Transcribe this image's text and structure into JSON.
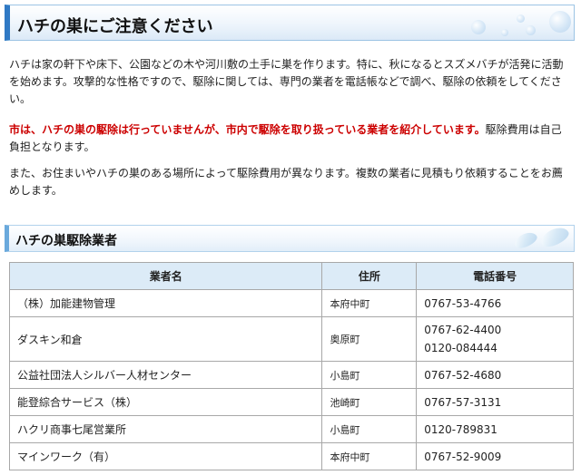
{
  "header": {
    "title": "ハチの巣にご注意ください"
  },
  "body": {
    "para1": "ハチは家の軒下や床下、公園などの木や河川敷の土手に巣を作ります。特に、秋になるとスズメバチが活発に活動を始めます。攻撃的な性格ですので、駆除に関しては、専門の業者を電話帳などで調べ、駆除の依頼をしてください。",
    "para2_warning": "市は、ハチの巣の駆除は行っていませんが、市内で駆除を取り扱っている業者を紹介しています。",
    "para2_rest": "駆除費用は自己負担となります。",
    "para3": "また、お住まいやハチの巣のある場所によって駆除費用が異なります。複数の業者に見積もり依頼することをお薦めします。"
  },
  "section": {
    "title": "ハチの巣駆除業者"
  },
  "table": {
    "headers": [
      "業者名",
      "住所",
      "電話番号"
    ],
    "rows": [
      {
        "name": "（株）加能建物管理",
        "area": "本府中町",
        "phones": [
          "0767-53-4766"
        ]
      },
      {
        "name": "ダスキン和倉",
        "area": "奥原町",
        "phones": [
          "0767-62-4400",
          "0120-084444"
        ]
      },
      {
        "name": "公益社団法人シルバー人材センター",
        "area": "小島町",
        "phones": [
          "0767-52-4680"
        ]
      },
      {
        "name": "能登綜合サービス（株）",
        "area": "池崎町",
        "phones": [
          "0767-57-3131"
        ]
      },
      {
        "name": "ハクリ商事七尾営業所",
        "area": "小島町",
        "phones": [
          "0120-789831"
        ]
      },
      {
        "name": "マインワーク（有）",
        "area": "本府中町",
        "phones": [
          "0767-52-9009"
        ]
      }
    ]
  },
  "colors": {
    "warning_text": "#cc0000",
    "header_accent": "#2f79c4",
    "table_header_bg": "#dcebf7",
    "table_border": "#a8a8a8"
  }
}
